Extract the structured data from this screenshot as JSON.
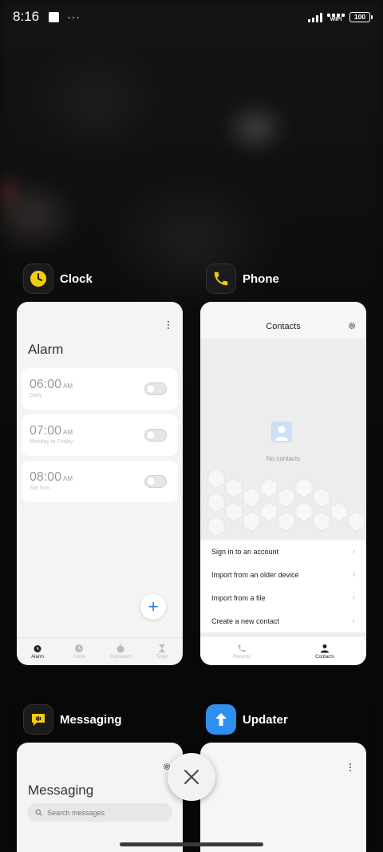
{
  "status_bar": {
    "time": "8:16",
    "dots": "···",
    "wifi_label": "WIFI",
    "battery": "100"
  },
  "apps": [
    {
      "name": "Clock",
      "icon": "clock-icon",
      "screen": {
        "title": "Alarm",
        "alarms": [
          {
            "time": "06:00",
            "ampm": "AM",
            "repeat": "Daily",
            "enabled": false
          },
          {
            "time": "07:00",
            "ampm": "AM",
            "repeat": "Monday to Friday",
            "enabled": false
          },
          {
            "time": "08:00",
            "ampm": "AM",
            "repeat": "Sat Sun",
            "enabled": false
          }
        ],
        "fab": "+",
        "nav": [
          "Alarm",
          "Clock",
          "Stopwatch",
          "Timer"
        ],
        "active_nav": "Alarm"
      }
    },
    {
      "name": "Phone",
      "icon": "phone-icon",
      "screen": {
        "title": "Contacts",
        "empty_text": "No contacts",
        "options": [
          "Sign in to an account",
          "Import from an older device",
          "Import from a file",
          "Create a new contact"
        ],
        "nav": [
          "Recents",
          "Contacts"
        ],
        "active_nav": "Contacts"
      }
    },
    {
      "name": "Messaging",
      "icon": "messaging-icon",
      "screen": {
        "title": "Messaging",
        "search_placeholder": "Search messages"
      }
    },
    {
      "name": "Updater",
      "icon": "updater-icon",
      "screen": {}
    }
  ],
  "colors": {
    "accent_yellow": "#f5cd0b",
    "accent_blue": "#2b7de9",
    "updater_blue": "#2f8ff0"
  },
  "close_button": "close-icon"
}
